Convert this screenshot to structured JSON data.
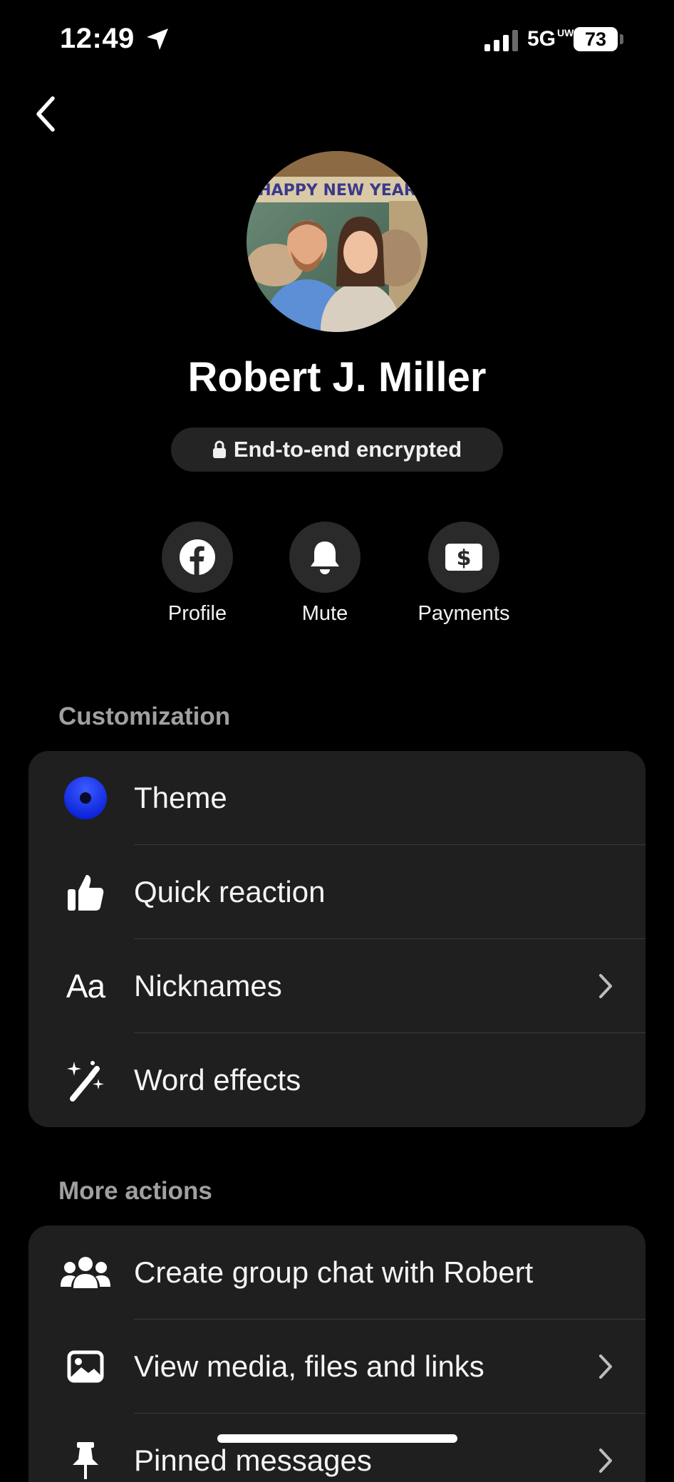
{
  "status_bar": {
    "time": "12:49",
    "network": "5G",
    "network_sup": "UW",
    "battery": "73"
  },
  "contact": {
    "name": "Robert J. Miller",
    "encryption_label": "End-to-end encrypted",
    "avatar_banner_text": "HAPPY NEW YEAR"
  },
  "actions": [
    {
      "label": "Profile",
      "icon": "facebook-icon"
    },
    {
      "label": "Mute",
      "icon": "bell-icon"
    },
    {
      "label": "Payments",
      "icon": "dollar-icon"
    }
  ],
  "customization": {
    "title": "Customization",
    "items": [
      {
        "label": "Theme",
        "icon": "theme-icon"
      },
      {
        "label": "Quick reaction",
        "icon": "thumbs-up-icon"
      },
      {
        "label": "Nicknames",
        "icon": "aa-icon",
        "icon_text": "Aa"
      },
      {
        "label": "Word effects",
        "icon": "magic-wand-icon"
      }
    ]
  },
  "more_actions": {
    "title": "More actions",
    "items": [
      {
        "label": "Create group chat with Robert",
        "icon": "group-icon"
      },
      {
        "label": "View media, files and links",
        "icon": "image-icon"
      },
      {
        "label": "Pinned messages",
        "icon": "pin-icon"
      }
    ]
  },
  "colors": {
    "background": "#000000",
    "card": "#1f1f1f",
    "theme_accent": "#1a3cff"
  }
}
